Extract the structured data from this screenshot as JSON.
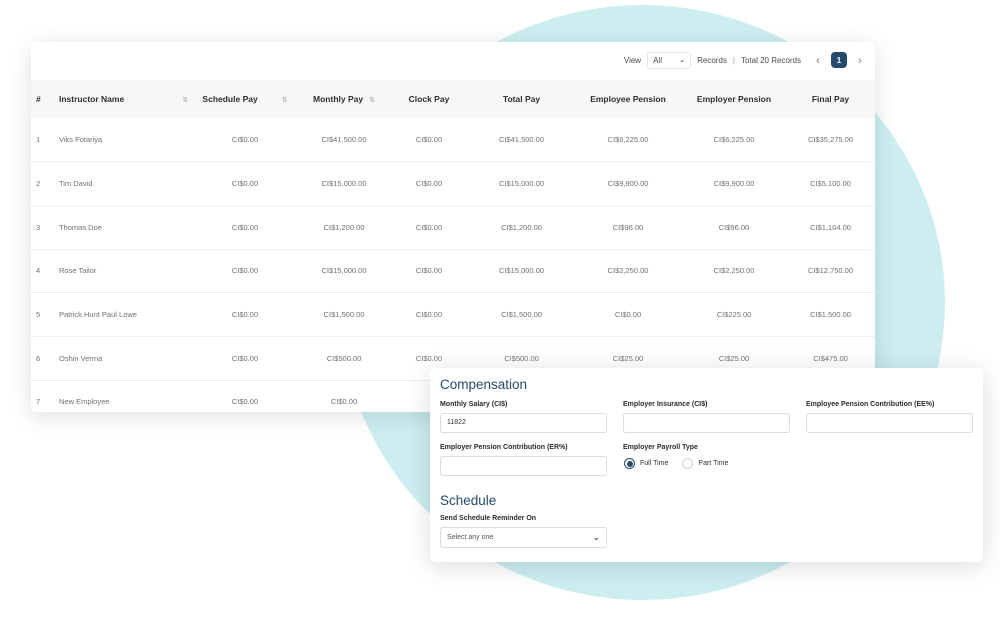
{
  "toolbar": {
    "view_label": "View",
    "view_value": "All",
    "records_label": "Records",
    "separator": "|",
    "total_label": "Total 20 Records",
    "current_page": "1",
    "prev_icon": "chevron-left-icon",
    "next_icon": "chevron-right-icon"
  },
  "table": {
    "headers": [
      "#",
      "Instructor Name",
      "Schedule Pay",
      "Monthly Pay",
      "Clock Pay",
      "Total Pay",
      "Employee Pension",
      "Employer Pension",
      "Final Pay"
    ],
    "rows": [
      [
        "1",
        "Viks Fotariya",
        "CI$0.00",
        "CI$41,500.00",
        "CI$0.00",
        "CI$41,500.00",
        "CI$6,225.00",
        "CI$6,225.00",
        "CI$35,275.00"
      ],
      [
        "2",
        "Tim David",
        "CI$0.00",
        "CI$15,000.00",
        "CI$0.00",
        "CI$15,000.00",
        "CI$9,900.00",
        "CI$9,900.00",
        "CI$5,100.00"
      ],
      [
        "3",
        "Thomas Doe",
        "CI$0.00",
        "CI$1,200.00",
        "CI$0.00",
        "CI$1,200.00",
        "CI$96.00",
        "CI$96.00",
        "CI$1,104.00"
      ],
      [
        "4",
        "Rose Tailor",
        "CI$0.00",
        "CI$15,000.00",
        "CI$0.00",
        "CI$15,000.00",
        "CI$2,250.00",
        "CI$2,250.00",
        "CI$12,750.00"
      ],
      [
        "5",
        "Patrick Hunt Paul Lowe",
        "CI$0.00",
        "CI$1,500.00",
        "CI$0.00",
        "CI$1,500.00",
        "CI$0.00",
        "CI$225.00",
        "CI$1,500.00"
      ],
      [
        "6",
        "Oshin Verma",
        "CI$0.00",
        "CI$500.00",
        "CI$0.00",
        "CI$500.00",
        "CI$25.00",
        "CI$25.00",
        "CI$475.00"
      ],
      [
        "7",
        "New Employee",
        "CI$0.00",
        "CI$0.00",
        "",
        "",
        "",
        "",
        ""
      ]
    ]
  },
  "compensation": {
    "title": "Compensation",
    "monthly_salary_label": "Monthly Salary (CI$)",
    "monthly_salary_value": "11822",
    "employer_insurance_label": "Employer Insurance (CI$)",
    "employer_insurance_value": "",
    "employee_pension_label": "Employee Pension Contribution (EE%)",
    "employee_pension_value": "",
    "employer_pension_label": "Employer Pension Contribution (ER%)",
    "employer_pension_value": "",
    "payroll_type_label": "Employer Payroll Type",
    "payroll_options": [
      "Full Time",
      "Part Time"
    ],
    "payroll_selected": "Full Time"
  },
  "schedule": {
    "title": "Schedule",
    "reminder_label": "Send Schedule Reminder On",
    "reminder_placeholder": "Select any one"
  },
  "colors": {
    "accent": "#234b6e",
    "background_circle": "#cdeef0"
  }
}
